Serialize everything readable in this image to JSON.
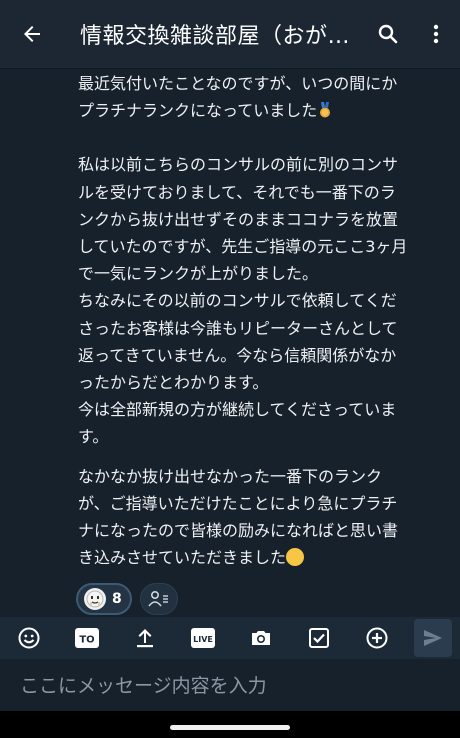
{
  "header": {
    "title": "情報交換雑談部屋（おが…",
    "back_icon": "arrow-left-icon",
    "search_icon": "search-icon",
    "menu_icon": "more-vert-icon"
  },
  "message": {
    "paragraph1_line1": "最近気付いたことなのですが、いつの間にか",
    "paragraph1_line2": "プラチナランクになっていました",
    "paragraph2": [
      "私は以前こちらのコンサルの前に別のコンサ",
      "ルを受けておりまして、それでも一番下のラ",
      "ンクから抜け出せずそのままココナラを放置",
      "していたのですが、先生ご指導の元ここ3ヶ月",
      "で一気にランクが上がりました。",
      "ちなみにその以前のコンサルで依頼してくだ",
      "さったお客様は今誰もリピーターさんとして",
      "返ってきていません。今なら信頼関係がなか",
      "ったからだとわかります。",
      "今は全部新規の方が継続してくださっていま",
      "す。"
    ],
    "paragraph3_lines": [
      "なかなか抜け出せなかった一番下のランク",
      "が、ご指導いただけたことにより急にプラチ",
      "ナになったので皆様の励みになればと思い書"
    ],
    "paragraph3_last": "き込みさせていただきました"
  },
  "reactions": {
    "count": "8",
    "reaction_icon": "face-emoji-icon",
    "add_icon": "add-reaction-icon"
  },
  "toolbar": {
    "emoji_icon": "smiley-icon",
    "to_label": "TO",
    "upload_icon": "upload-icon",
    "live_label": "LIVE",
    "camera_icon": "camera-icon",
    "task_icon": "checkbox-icon",
    "plus_icon": "plus-circle-icon",
    "send_icon": "send-icon"
  },
  "composer": {
    "placeholder": "ここにメッセージ内容を入力"
  },
  "colors": {
    "background": "#17212b",
    "appbar": "#1c2733",
    "toolbar": "#1c2a38",
    "text": "#eef1f4"
  }
}
